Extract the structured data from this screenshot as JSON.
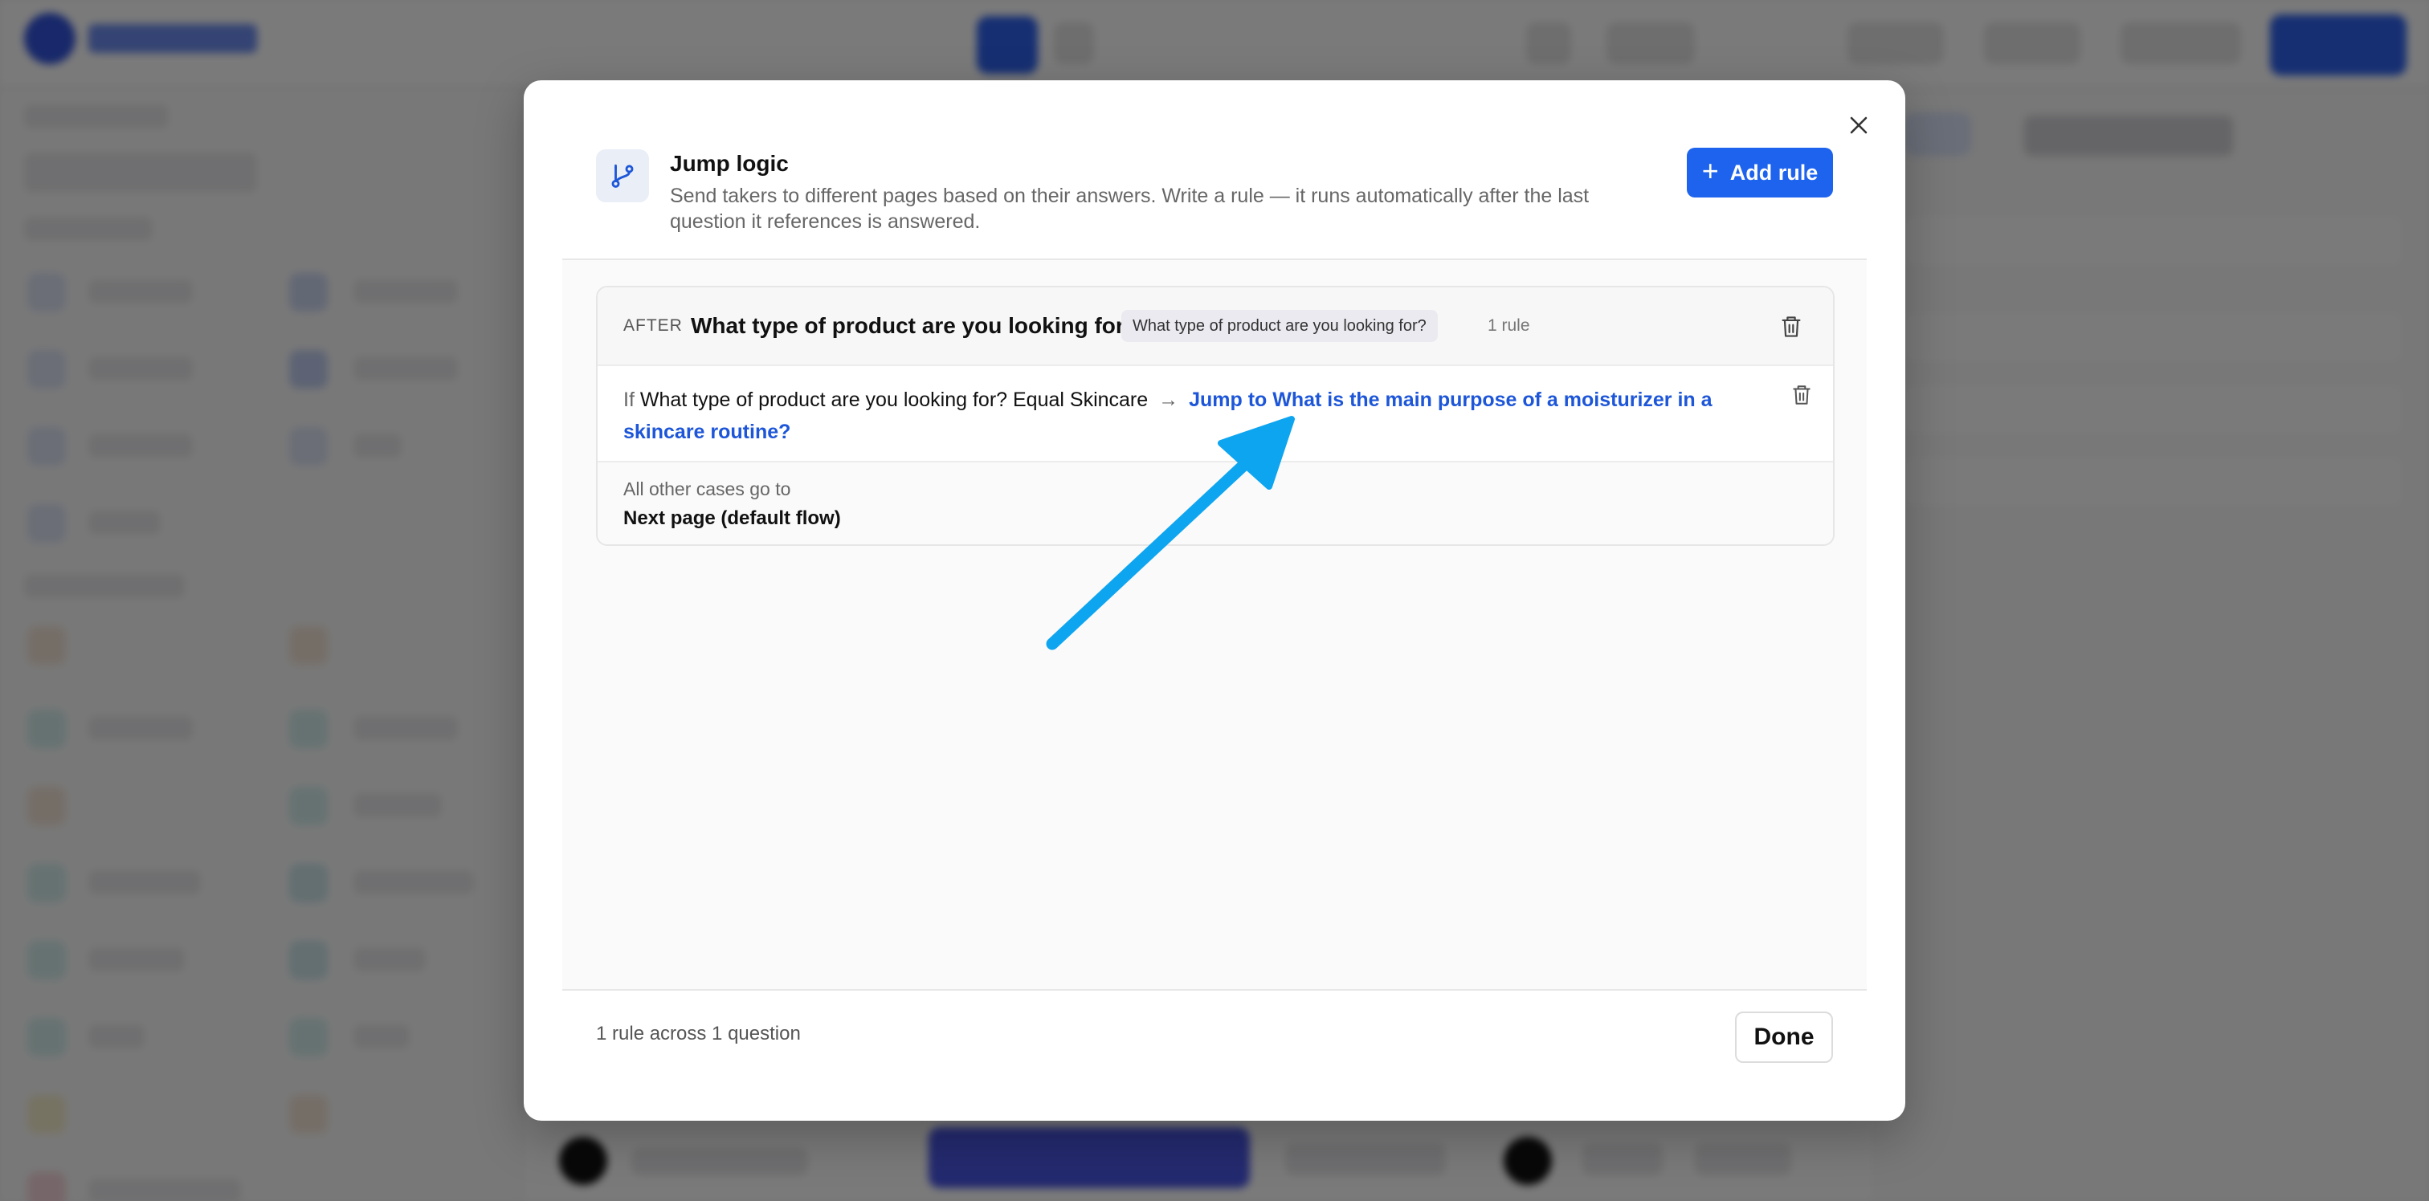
{
  "modal": {
    "title": "Jump logic",
    "description": "Send takers to different pages based on their answers. Write a rule — it runs automatically after the last question it references is answered.",
    "add_rule_label": "Add rule",
    "close_icon": "close-icon",
    "header_icon": "branch-icon"
  },
  "group": {
    "after_label": "AFTER",
    "question": "What type of product are you looking for?",
    "question_pill": "What type of product are you looking for?",
    "rule_count": "1 rule"
  },
  "rule": {
    "if_label": "If",
    "condition": "What type of product are you looking for? Equal Skincare",
    "arrow": "→",
    "target": "Jump to What is the main purpose of a moisturizer in a skincare routine?"
  },
  "default": {
    "label": "All other cases go to",
    "value": "Next page (default flow)"
  },
  "footer": {
    "summary": "1 rule across 1 question",
    "done_label": "Done"
  },
  "colors": {
    "accent": "#1d63ed",
    "link": "#1d56d8",
    "annotation_arrow": "#0ea5f0"
  }
}
